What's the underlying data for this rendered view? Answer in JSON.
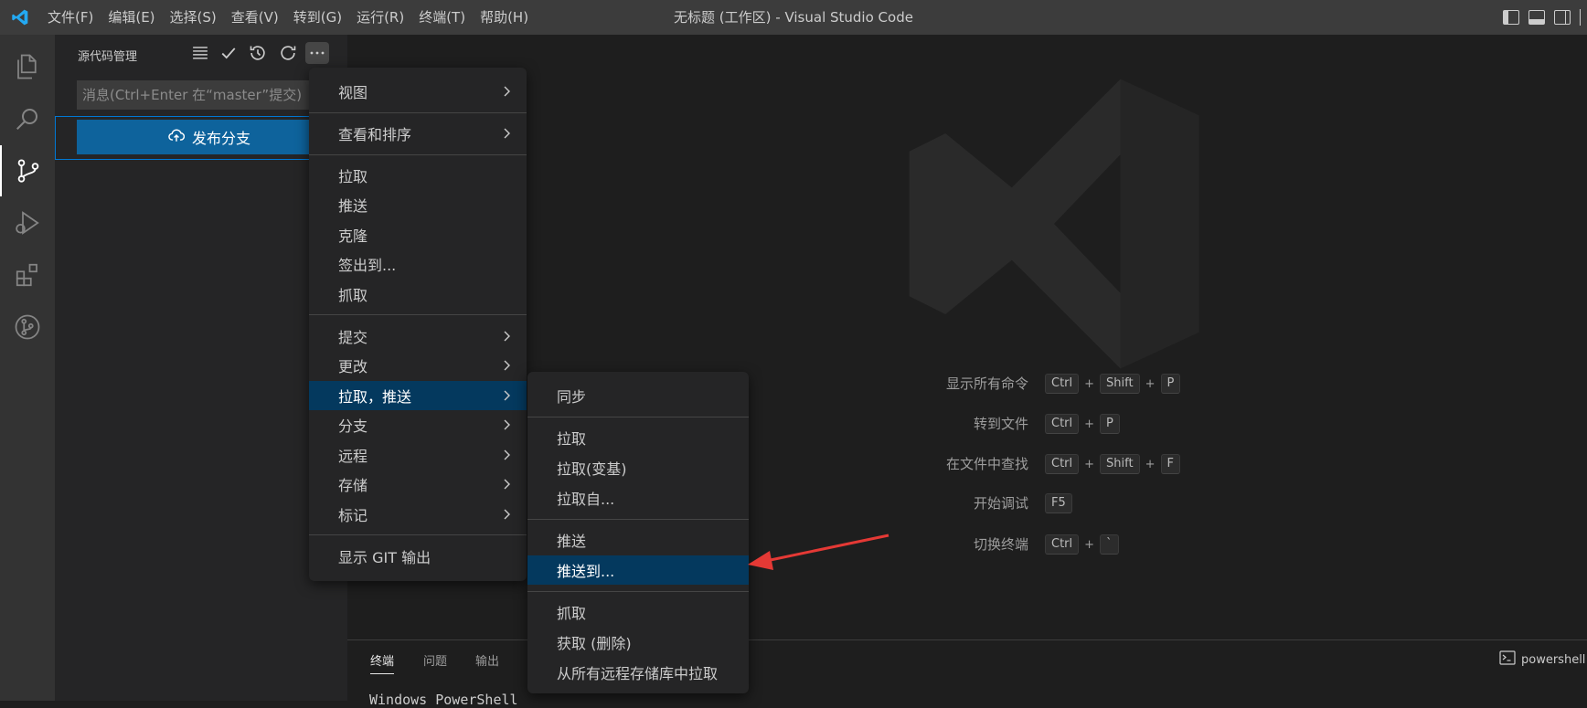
{
  "titlebar": {
    "menu": [
      "文件(F)",
      "编辑(E)",
      "选择(S)",
      "查看(V)",
      "转到(G)",
      "运行(R)",
      "终端(T)",
      "帮助(H)"
    ],
    "title": "无标题 (工作区) - Visual Studio Code"
  },
  "activitybar": {
    "items": [
      "explorer-icon",
      "search-icon",
      "source-control-icon",
      "run-debug-icon",
      "extensions-icon",
      "git-graph-icon"
    ],
    "active": "source-control-icon"
  },
  "sidebar": {
    "title": "源代码管理",
    "message_placeholder": "消息(Ctrl+Enter 在“master”提交)",
    "publish_label": "发布分支"
  },
  "main_menu": {
    "items": [
      {
        "label": "视图",
        "submenu": true
      },
      {
        "label": "查看和排序",
        "submenu": true
      },
      {
        "label": "拉取",
        "submenu": false
      },
      {
        "label": "推送",
        "submenu": false
      },
      {
        "label": "克隆",
        "submenu": false
      },
      {
        "label": "签出到...",
        "submenu": false
      },
      {
        "label": "抓取",
        "submenu": false
      },
      {
        "label": "提交",
        "submenu": true
      },
      {
        "label": "更改",
        "submenu": true
      },
      {
        "label": "拉取，推送",
        "submenu": true,
        "highlighted": true
      },
      {
        "label": "分支",
        "submenu": true
      },
      {
        "label": "远程",
        "submenu": true
      },
      {
        "label": "存储",
        "submenu": true
      },
      {
        "label": "标记",
        "submenu": true
      },
      {
        "label": "显示 GIT 输出",
        "submenu": false
      }
    ]
  },
  "sub_menu": {
    "items": [
      {
        "label": "同步"
      },
      {
        "label": "拉取"
      },
      {
        "label": "拉取(变基)"
      },
      {
        "label": "拉取自..."
      },
      {
        "label": "推送"
      },
      {
        "label": "推送到...",
        "highlighted": true
      },
      {
        "label": "抓取"
      },
      {
        "label": "获取 (删除)"
      },
      {
        "label": "从所有远程存储库中拉取"
      }
    ]
  },
  "shortcuts": [
    {
      "label": "显示所有命令",
      "keys": [
        "Ctrl",
        "Shift",
        "P"
      ]
    },
    {
      "label": "转到文件",
      "keys": [
        "Ctrl",
        "P"
      ]
    },
    {
      "label": "在文件中查找",
      "keys": [
        "Ctrl",
        "Shift",
        "F"
      ]
    },
    {
      "label": "开始调试",
      "keys": [
        "F5"
      ]
    },
    {
      "label": "切换终端",
      "keys": [
        "Ctrl",
        "`"
      ]
    }
  ],
  "panel": {
    "tabs": [
      "终端",
      "问题",
      "输出"
    ],
    "active_tab": "终端",
    "terminal_profile": "powershell",
    "terminal_text": "Windows PowerShell"
  },
  "colors": {
    "accent": "#0e639c",
    "highlight": "#04395e",
    "annotation_arrow": "#e53935"
  }
}
